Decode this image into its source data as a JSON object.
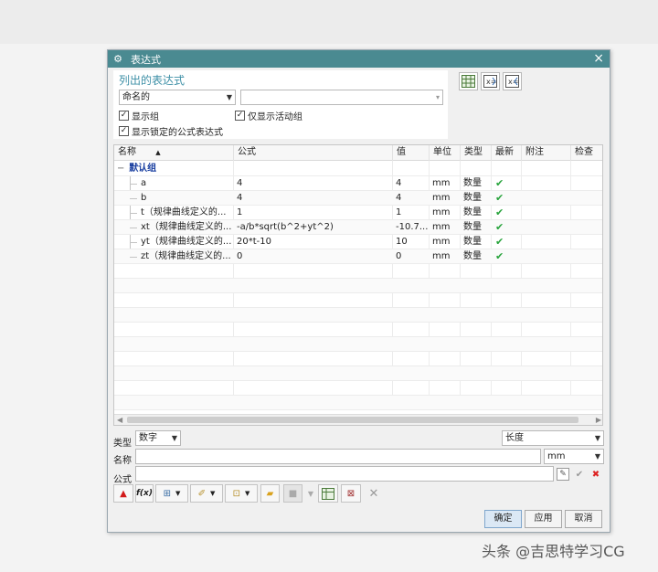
{
  "window": {
    "title": "表达式"
  },
  "listed": {
    "heading": "列出的表达式",
    "filter_value": "命名的",
    "search_value": "",
    "show_groups": "显示组",
    "show_active_only": "仅显示活动组",
    "show_locked": "显示锁定的公式表达式"
  },
  "table": {
    "columns": [
      "名称",
      "公式",
      "值",
      "单位",
      "类型",
      "最新",
      "附注",
      "检查"
    ],
    "group_name": "默认组",
    "group_toggle": "−",
    "rows": [
      {
        "name": "a",
        "formula": "4",
        "value": "4",
        "unit": "mm",
        "type": "数量"
      },
      {
        "name": "b",
        "formula": "4",
        "value": "4",
        "unit": "mm",
        "type": "数量"
      },
      {
        "name": "t（规律曲线定义的...",
        "formula": "1",
        "value": "1",
        "unit": "mm",
        "type": "数量"
      },
      {
        "name": "xt（规律曲线定义的...",
        "formula": "-a/b*sqrt(b^2+yt^2)",
        "value": "-10.7...",
        "unit": "mm",
        "type": "数量"
      },
      {
        "name": "yt（规律曲线定义的...",
        "formula": "20*t-10",
        "value": "10",
        "unit": "mm",
        "type": "数量"
      },
      {
        "name": "zt（规律曲线定义的...",
        "formula": "0",
        "value": "0",
        "unit": "mm",
        "type": "数量"
      }
    ]
  },
  "edit": {
    "type_label": "类型",
    "type_value": "数字",
    "dimension_value": "长度",
    "name_label": "名称",
    "name_value": "",
    "unit_value": "mm",
    "formula_label": "公式",
    "formula_value": ""
  },
  "buttons": {
    "ok": "确定",
    "apply": "应用",
    "cancel": "取消"
  },
  "watermark": "头条 @吉思特学习CG",
  "colors": {
    "titlebar": "#4a8a91",
    "check": "#27a33b",
    "heading": "#3d8fa6",
    "group": "#1a3fa0"
  }
}
